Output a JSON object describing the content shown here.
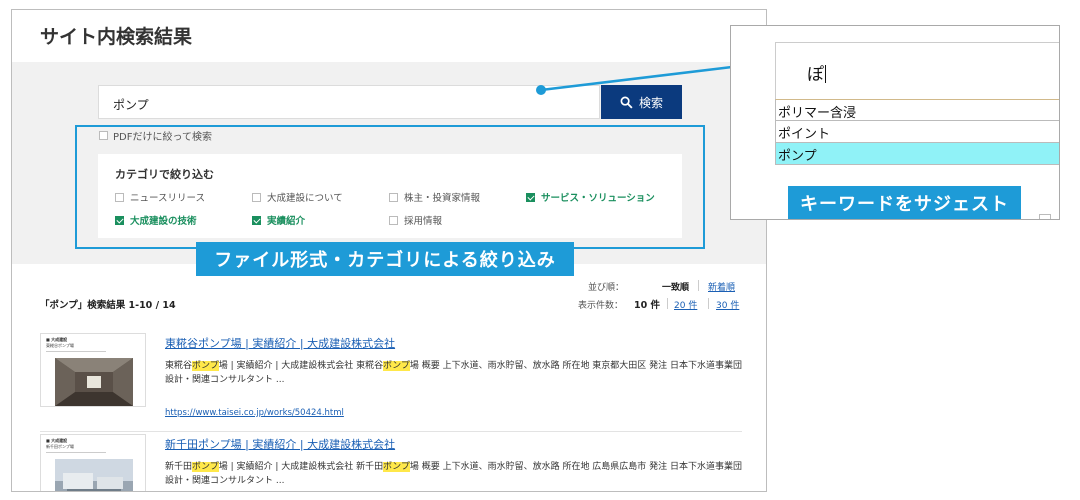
{
  "page": {
    "title": "サイト内検索結果"
  },
  "search": {
    "value": "ポンプ",
    "button_label": "検索",
    "pdf_only_label": "PDFだけに絞って検索",
    "pdf_only_checked": false
  },
  "categories": {
    "title": "カテゴリで絞り込む",
    "items": [
      {
        "label": "ニュースリリース",
        "checked": false
      },
      {
        "label": "大成建設について",
        "checked": false
      },
      {
        "label": "株主・投資家情報",
        "checked": false
      },
      {
        "label": "サービス・ソリューション",
        "checked": true
      },
      {
        "label": "大成建設の技術",
        "checked": true
      },
      {
        "label": "実績紹介",
        "checked": true
      },
      {
        "label": "採用情報",
        "checked": false
      }
    ]
  },
  "callouts": {
    "filter": "ファイル形式・カテゴリによる絞り込み",
    "suggest": "キーワードをサジェスト"
  },
  "sort": {
    "label": "並び順：",
    "active": "一致順",
    "other": "新着順"
  },
  "count": {
    "label": "表示件数：",
    "active": "10 件",
    "opt20": "20 件",
    "opt30": "30 件"
  },
  "results_summary": "「ポンプ」検索結果 1-10 / 14",
  "results": [
    {
      "title": "東糀谷ポンプ場 | 実績紹介 | 大成建設株式会社",
      "snippet_parts": [
        "東糀谷",
        "ポンプ",
        "場 | 実績紹介 | 大成建設株式会社 東糀谷",
        "ポンプ",
        "場 概要 上下水道、雨水貯留、放水路 所在地 東京都大田区 発注 日本下水道事業団 設計・関連コンサルタント ..."
      ],
      "url": "https://www.taisei.co.jp/works/50424.html",
      "thumb_logo": "■ 大成建設",
      "thumb_title": "東糀谷ポンプ場"
    },
    {
      "title": "新千田ポンプ場 | 実績紹介 | 大成建設株式会社",
      "snippet_parts": [
        "新千田",
        "ポンプ",
        "場 | 実績紹介 | 大成建設株式会社 新千田",
        "ポンプ",
        "場 概要 上下水道、雨水貯留、放水路 所在地 広島県広島市 発注 日本下水道事業団 設計・関連コンサルタント ..."
      ],
      "url": "",
      "thumb_logo": "■ 大成建設",
      "thumb_title": "新千田ポンプ場"
    }
  ],
  "suggest": {
    "typed": "ぽ",
    "items": [
      "ポリマー含浸",
      "ポイント",
      "ポンプ"
    ],
    "active_index": 2
  },
  "colors": {
    "accent_blue": "#1e9bd7",
    "button_navy": "#0b3a7e",
    "check_green": "#1a8f5e",
    "highlight": "#ffe84a",
    "suggest_active": "#90f2f7"
  }
}
